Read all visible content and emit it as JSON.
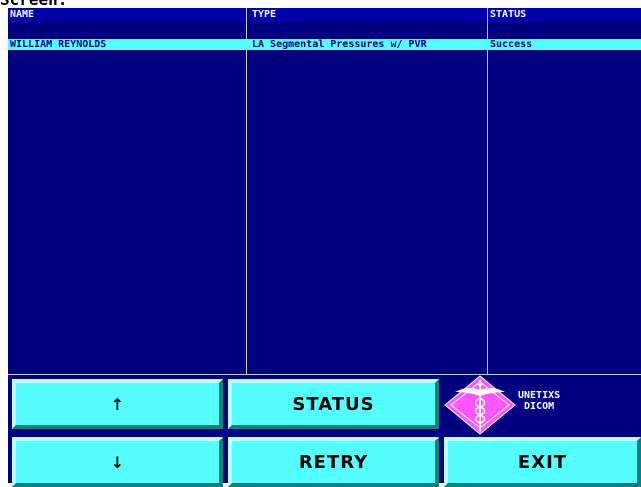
{
  "window": {
    "top_caption": "Screen:"
  },
  "table": {
    "columns": [
      "NAME",
      "TYPE",
      "STATUS"
    ],
    "rows": [
      {
        "name": "WILLIAM REYNOLDS",
        "type": "LA Segmental Pressures w/ PVR",
        "status": "Success",
        "selected": true
      }
    ]
  },
  "buttons": {
    "up": "↑",
    "status": "STATUS",
    "down": "↓",
    "retry": "RETRY",
    "exit": "EXIT"
  },
  "logo": {
    "line1": "UNETIXS",
    "line2": "DICOM",
    "icon": "caduceus-diamond-icon"
  },
  "colors": {
    "panel_bg": "#000080",
    "selected_row_bg": "#55ffff",
    "button_face": "#55ffff",
    "logo_color": "#ff55ff"
  }
}
